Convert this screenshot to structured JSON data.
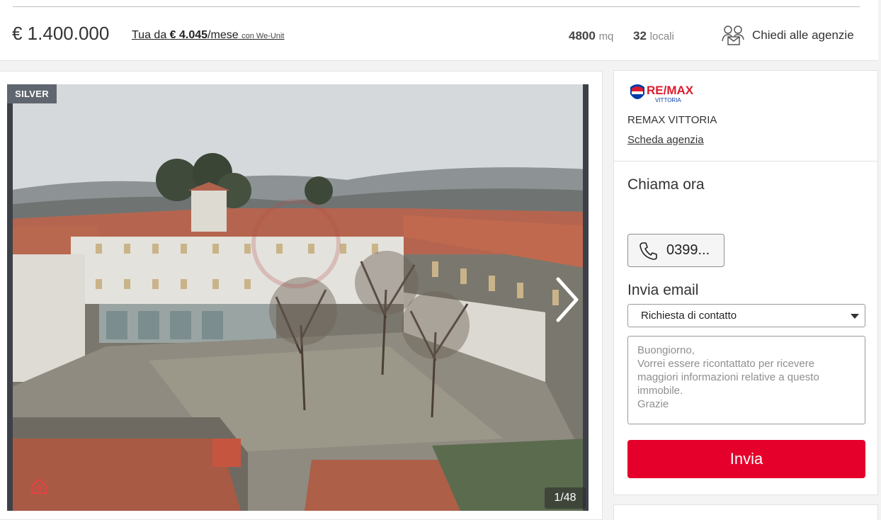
{
  "header": {
    "price": "€ 1.400.000",
    "mortgage_prefix": "Tua da ",
    "mortgage_amount": "€ 4.045",
    "mortgage_suffix": "/mese",
    "mortgage_partner": "con We-Unit",
    "area_value": "4800",
    "area_unit": "mq",
    "rooms_value": "32",
    "rooms_unit": "locali",
    "ask_agencies_label": "Chiedi alle agenzie",
    "ask_agencies_icon": "people-envelope-icon"
  },
  "gallery": {
    "badge": "SILVER",
    "counter": "1/48",
    "next_icon": "chevron-right-icon",
    "photo_description_icon": "building-photo"
  },
  "agency": {
    "logo_text": "RE/MAX",
    "logo_sub": "VITTORIA",
    "name": "REMAX VITTORIA",
    "link_label": "Scheda agenzia",
    "call_title": "Chiama ora",
    "phone_label": "0399...",
    "phone_icon": "phone-icon",
    "email_title": "Invia email",
    "subject_selected": "Richiesta di contatto",
    "message_placeholder": "Buongiorno,\nVorrei essere ricontattato per ricevere maggiori informazioni relative a questo immobile.\nGrazie",
    "send_label": "Invia"
  },
  "colors": {
    "accent_red": "#e4002b",
    "silver_badge": "#5f6670",
    "remax_blue": "#003da5",
    "remax_red": "#dc1c2e"
  }
}
